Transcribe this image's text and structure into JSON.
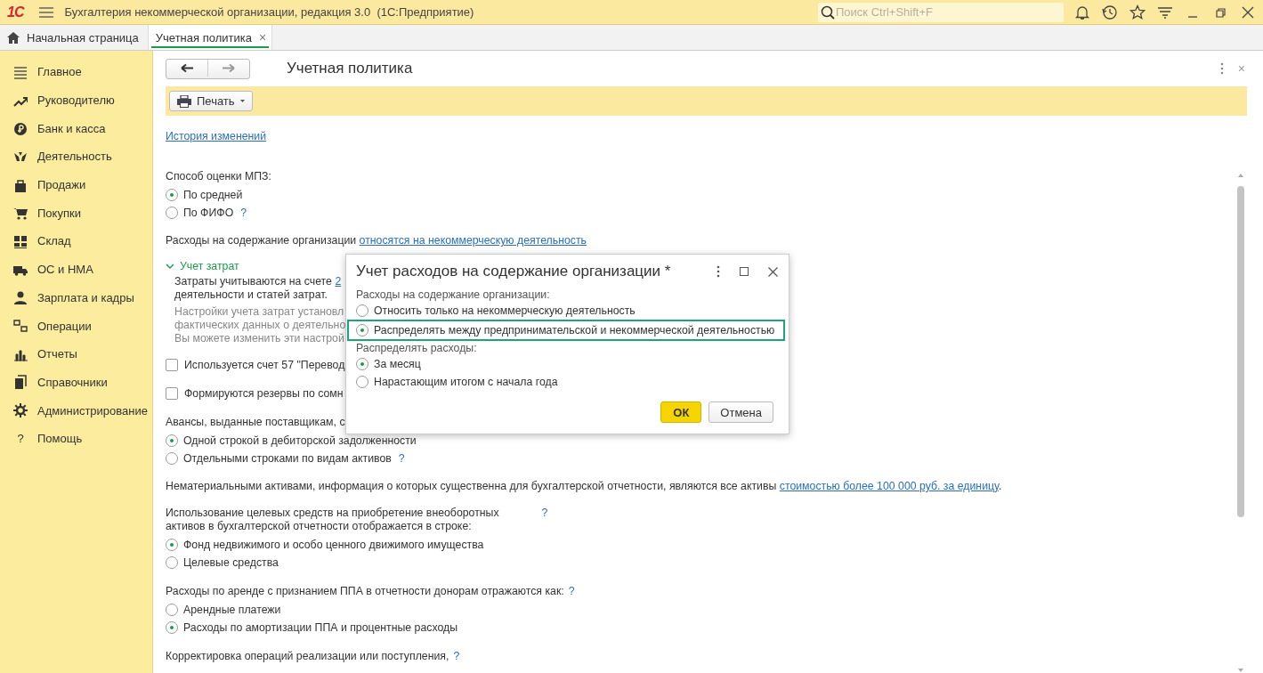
{
  "app_bar": {
    "logo": "1С",
    "title": "Бухгалтерия некоммерческой организации, редакция 3.0  (1С:Предприятие)",
    "search": {
      "placeholder": "Поиск Ctrl+Shift+F"
    }
  },
  "tabs": [
    {
      "label": "Начальная страница",
      "selected": false,
      "kind": "home"
    },
    {
      "label": "Учетная политика",
      "selected": true,
      "kind": "document",
      "close": "×"
    }
  ],
  "sidebar": {
    "items": [
      {
        "label": "Главное"
      },
      {
        "label": "Руководителю"
      },
      {
        "label": "Банк и касса"
      },
      {
        "label": "Деятельность"
      },
      {
        "label": "Продажи"
      },
      {
        "label": "Покупки"
      },
      {
        "label": "Склад"
      },
      {
        "label": "ОС и НМА"
      },
      {
        "label": "Зарплата и кадры"
      },
      {
        "label": "Операции"
      },
      {
        "label": "Отчеты"
      },
      {
        "label": "Справочники"
      },
      {
        "label": "Администрирование"
      },
      {
        "label": "Помощь",
        "glyph": "?"
      }
    ]
  },
  "form": {
    "title": "Учетная политика",
    "close": "×",
    "print_button": "Печать",
    "blocks": [
      {
        "kind": "link",
        "text": "История изменений"
      },
      {
        "kind": "radio_group",
        "label": [
          "Способ оценки МПЗ:"
        ],
        "options": [
          {
            "label": "По средней",
            "selected": true
          },
          {
            "label": "По ФИФО",
            "selected": false,
            "help": "?"
          }
        ]
      },
      {
        "kind": "sentence",
        "text": "Расходы на содержание организации ",
        "link": "относятся на некоммерческую деятельность"
      },
      {
        "kind": "expander",
        "label": "Учет затрат",
        "expanded": true,
        "text": "Затраты учитываются на счете ",
        "link": "2",
        "text2": "деятельности и статей затрат.",
        "note_lines": [
          "Настройки учета затрат установл",
          "фактических данных о деятельно",
          "Вы можете изменить эти настрой"
        ]
      },
      {
        "kind": "checkbox",
        "label": "Используется счет 57 \"Перевод",
        "checked": false
      },
      {
        "kind": "checkbox",
        "label": "Формируются резервы по сомн",
        "checked": false
      },
      {
        "kind": "radio_group",
        "label": [
          "Авансы, выданные поставщикам, с"
        ],
        "options": [
          {
            "label": "Одной строкой в дебиторской задолженности",
            "selected": true
          },
          {
            "label": "Отдельными строками по видам активов",
            "selected": false,
            "help": "?"
          }
        ]
      },
      {
        "kind": "sentence",
        "text": "Нематериальными активами, информация о которых существенна для бухгалтерской отчетности, являются все активы ",
        "link": "стоимостью более 100 000 руб. за единицу",
        "tail": "."
      },
      {
        "kind": "radio_group",
        "label": [
          "Использование целевых средств на приобретение внеоборотных",
          "активов в бухгалтерской отчетности отображается в строке:"
        ],
        "help": "?",
        "options": [
          {
            "label": "Фонд недвижимого и особо ценного движимого имущества",
            "selected": true
          },
          {
            "label": "Целевые средства",
            "selected": false
          }
        ]
      },
      {
        "kind": "radio_group",
        "label": [
          "Расходы по аренде с признанием ППА в отчетности донорам отражаются как:"
        ],
        "help": "?",
        "options": [
          {
            "label": "Арендные платежи",
            "selected": false
          },
          {
            "label": "Расходы по амортизации ППА и процентные расходы",
            "selected": true
          }
        ]
      },
      {
        "kind": "radio_group",
        "label": [
          "Корректировка операций реализации или поступления,"
        ],
        "help": "?"
      }
    ]
  },
  "dialog": {
    "title": "Учет расходов на содержание организации *",
    "groups": [
      {
        "label": "Расходы на содержание организации:",
        "options": [
          {
            "label": "Относить только на некоммерческую деятельность",
            "selected": false,
            "highlighted": false
          },
          {
            "label": "Распределять между предпринимательской и некоммерческой деятельностью",
            "selected": true,
            "highlighted": true
          }
        ]
      },
      {
        "label": "Распределять расходы:",
        "options": [
          {
            "label": "За месяц",
            "selected": true,
            "highlighted": false
          },
          {
            "label": "Нарастающим итогом с начала года",
            "selected": false,
            "highlighted": false
          }
        ]
      }
    ],
    "buttons": [
      {
        "label": "ОК",
        "kind": "default"
      },
      {
        "label": "Отмена",
        "kind": "normal"
      }
    ]
  }
}
